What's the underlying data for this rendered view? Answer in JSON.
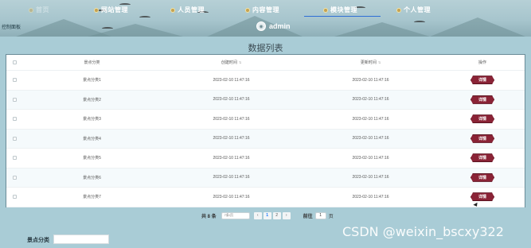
{
  "header": {
    "nav": [
      {
        "label": "首页",
        "active": false
      },
      {
        "label": "网站管理",
        "active": false
      },
      {
        "label": "人员管理",
        "active": false
      },
      {
        "label": "内容管理",
        "active": false
      },
      {
        "label": "模块管理",
        "active": true
      },
      {
        "label": "个人管理",
        "active": false
      }
    ],
    "left_label": "控制面板",
    "username": "admin"
  },
  "page_title": "数据列表",
  "table": {
    "columns": [
      "景点分类",
      "创建时间",
      "更新时间",
      "操作"
    ],
    "rows": [
      {
        "category": "景点分类1",
        "created": "2023-02-10 11:47:16",
        "updated": "2023-02-10 11:47:16",
        "action": "详情"
      },
      {
        "category": "景点分类2",
        "created": "2023-02-10 11:47:16",
        "updated": "2023-02-10 11:47:16",
        "action": "详情"
      },
      {
        "category": "景点分类3",
        "created": "2023-02-10 11:47:16",
        "updated": "2023-02-10 11:47:16",
        "action": "详情"
      },
      {
        "category": "景点分类4",
        "created": "2023-02-10 11:47:16",
        "updated": "2023-02-10 11:47:16",
        "action": "详情"
      },
      {
        "category": "景点分类5",
        "created": "2023-02-10 11:47:16",
        "updated": "2023-02-10 11:47:16",
        "action": "详情"
      },
      {
        "category": "景点分类6",
        "created": "2023-02-10 11:47:16",
        "updated": "2023-02-10 11:47:16",
        "action": "详情"
      },
      {
        "category": "景点分类7",
        "created": "2023-02-10 11:47:16",
        "updated": "2023-02-10 11:47:16",
        "action": "详情"
      }
    ]
  },
  "pagination": {
    "total": "共 8 条",
    "page_size": "7条/页",
    "prev": "‹",
    "pages": [
      "1",
      "2"
    ],
    "current_page": "1",
    "next": "›",
    "goto_label": "前往",
    "goto_value": "1",
    "goto_suffix": "页"
  },
  "filter": {
    "label": "景点分类",
    "value": ""
  },
  "watermark": "CSDN @weixin_bscxy322",
  "colors": {
    "accent": "#8a2336",
    "background": "#a9ccd6",
    "nav_underline": "#2f6fd6"
  }
}
